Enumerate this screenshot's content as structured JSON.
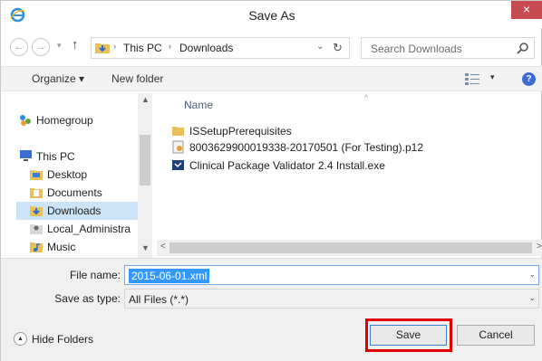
{
  "window": {
    "title": "Save As",
    "close_glyph": "×"
  },
  "icons": {
    "app": "ie-icon",
    "close": "close-icon",
    "back": "back-arrow-icon",
    "forward": "forward-arrow-icon",
    "up": "up-arrow-icon",
    "search": "search-icon",
    "refresh": "refresh-icon",
    "help": "help-icon"
  },
  "nav": {
    "back_glyph": "←",
    "forward_glyph": "→",
    "recent_glyph": "▾",
    "up_glyph": "↑",
    "breadcrumb": [
      "This PC",
      "Downloads"
    ],
    "separator": "›",
    "dropdown_glyph": "⌄",
    "refresh_glyph": "↻",
    "search_placeholder": "Search Downloads"
  },
  "toolbar": {
    "organize_label": "Organize ▾",
    "new_folder_label": "New folder",
    "view_drop_glyph": "▾",
    "help_glyph": "?"
  },
  "sidebar": {
    "items": [
      {
        "label": "Homegroup",
        "icon": "homegroup-icon"
      },
      {
        "label": "This PC",
        "icon": "computer-icon"
      },
      {
        "label": "Desktop",
        "icon": "folder-icon"
      },
      {
        "label": "Documents",
        "icon": "folder-icon"
      },
      {
        "label": "Downloads",
        "icon": "downloads-folder-icon",
        "selected": true
      },
      {
        "label": "Local_Administra",
        "icon": "user-folder-icon"
      },
      {
        "label": "Music",
        "icon": "music-folder-icon"
      }
    ],
    "scroll_up_glyph": "▲",
    "scroll_down_glyph": "▼"
  },
  "files": {
    "column_name": "Name",
    "sort_glyph": "^",
    "items": [
      {
        "name": "ISSetupPrerequisites",
        "icon": "folder-icon"
      },
      {
        "name": "8003629900019338-20170501 (For Testing).p12",
        "icon": "certificate-icon"
      },
      {
        "name": "Clinical Package Validator 2.4 Install.exe",
        "icon": "installer-icon"
      }
    ],
    "hscroll_left_glyph": "<",
    "hscroll_right_glyph": ">"
  },
  "form": {
    "file_name_label": "File name:",
    "file_name_value": "2015-06-01.xml",
    "save_type_label": "Save as type:",
    "save_type_value": "All Files (*.*)",
    "dropdown_glyph": "⌄"
  },
  "footer": {
    "hide_folders_glyph": "▲",
    "hide_folders_label": "Hide Folders",
    "save_label": "Save",
    "cancel_label": "Cancel"
  },
  "colors": {
    "close_red": "#c74b50",
    "selection_blue": "#3399ff",
    "sidebar_selected": "#cce4f7",
    "highlight_red": "#e00000",
    "folder_yellow": "#e8c15a"
  }
}
